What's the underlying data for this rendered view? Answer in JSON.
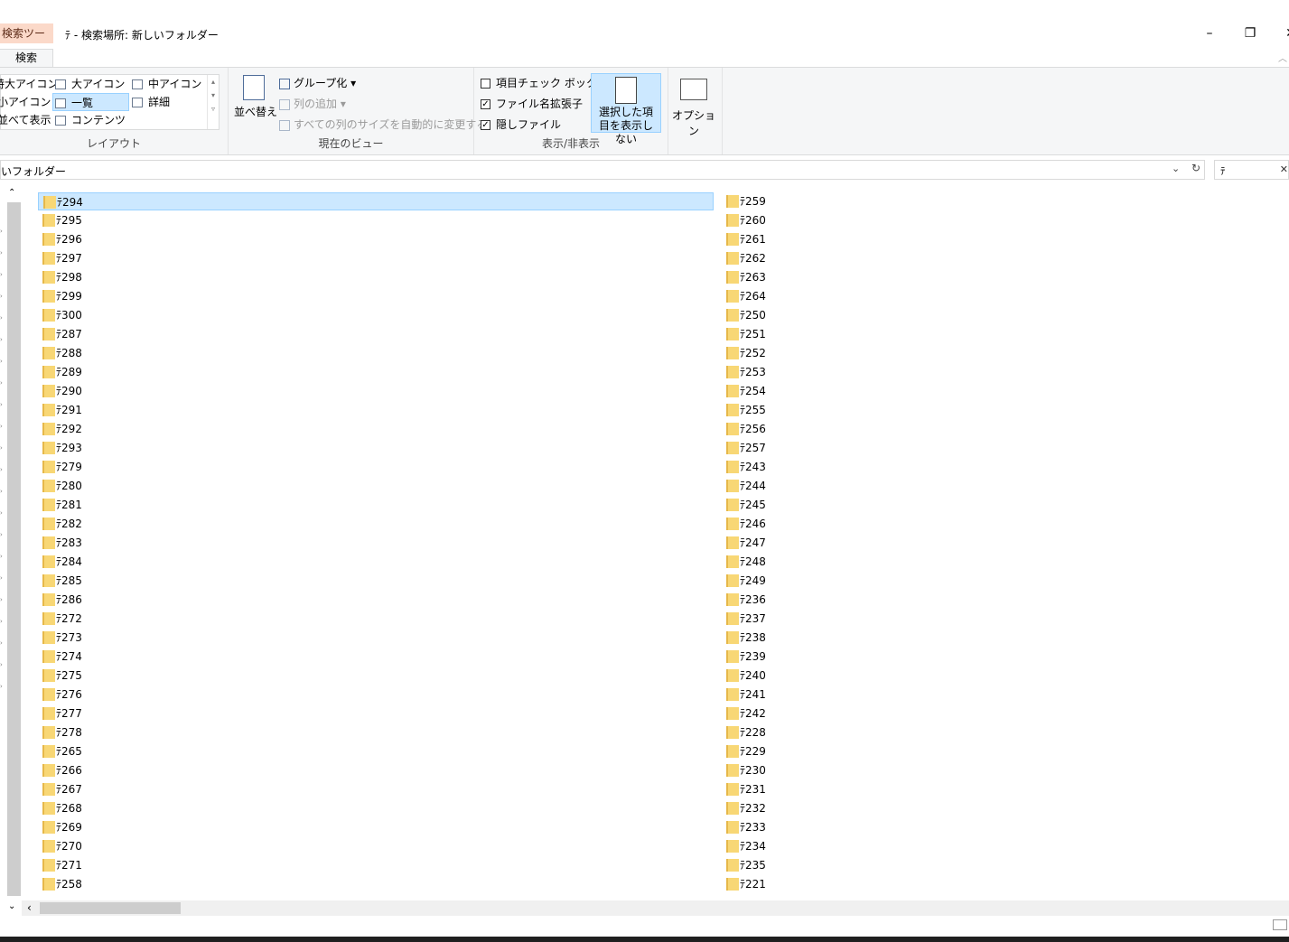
{
  "window": {
    "context_tab": "検索ツール",
    "title": "ﾃ - 検索場所: 新しいフォルダー",
    "minimize": "–",
    "maximize": "❐",
    "close": "✕"
  },
  "ribbon_tabs": {
    "active": "検索"
  },
  "ribbon": {
    "layout": {
      "label": "レイアウト",
      "items": [
        "特大アイコン",
        "大アイコン",
        "中アイコン",
        "小アイコン",
        "一覧",
        "詳細",
        "並べて表示",
        "コンテンツ"
      ],
      "selected": "一覧"
    },
    "current_view": {
      "label": "現在のビュー",
      "sort": "並べ替え",
      "group": "グループ化",
      "add_column": "列の追加",
      "size_columns": "すべての列のサイズを自動的に変更する"
    },
    "show_hide": {
      "label": "表示/非表示",
      "item_checkboxes": {
        "label": "項目チェック ボックス",
        "checked": false
      },
      "file_extensions": {
        "label": "ファイル名拡張子",
        "checked": true
      },
      "hidden_items": {
        "label": "隠しファイル",
        "checked": true
      },
      "hide_selected": "選択した項目を表示しない"
    },
    "options": "オプション"
  },
  "address": {
    "path": "いフォルダー",
    "search_value": "ﾃ"
  },
  "files": {
    "column1": [
      "ﾃ294",
      "ﾃ295",
      "ﾃ296",
      "ﾃ297",
      "ﾃ298",
      "ﾃ299",
      "ﾃ300",
      "ﾃ287",
      "ﾃ288",
      "ﾃ289",
      "ﾃ290",
      "ﾃ291",
      "ﾃ292",
      "ﾃ293",
      "ﾃ279",
      "ﾃ280",
      "ﾃ281",
      "ﾃ282",
      "ﾃ283",
      "ﾃ284",
      "ﾃ285",
      "ﾃ286",
      "ﾃ272",
      "ﾃ273",
      "ﾃ274",
      "ﾃ275",
      "ﾃ276",
      "ﾃ277",
      "ﾃ278",
      "ﾃ265",
      "ﾃ266",
      "ﾃ267",
      "ﾃ268",
      "ﾃ269",
      "ﾃ270",
      "ﾃ271",
      "ﾃ258"
    ],
    "column2": [
      "ﾃ259",
      "ﾃ260",
      "ﾃ261",
      "ﾃ262",
      "ﾃ263",
      "ﾃ264",
      "ﾃ250",
      "ﾃ251",
      "ﾃ252",
      "ﾃ253",
      "ﾃ254",
      "ﾃ255",
      "ﾃ256",
      "ﾃ257",
      "ﾃ243",
      "ﾃ244",
      "ﾃ245",
      "ﾃ246",
      "ﾃ247",
      "ﾃ248",
      "ﾃ249",
      "ﾃ236",
      "ﾃ237",
      "ﾃ238",
      "ﾃ239",
      "ﾃ240",
      "ﾃ241",
      "ﾃ242",
      "ﾃ228",
      "ﾃ229",
      "ﾃ230",
      "ﾃ231",
      "ﾃ232",
      "ﾃ233",
      "ﾃ234",
      "ﾃ235",
      "ﾃ221"
    ],
    "selected": "ﾃ294"
  },
  "colors": {
    "selection": "#cce8ff",
    "folder": "#f8d775",
    "context_tab": "#fbd9c9"
  }
}
